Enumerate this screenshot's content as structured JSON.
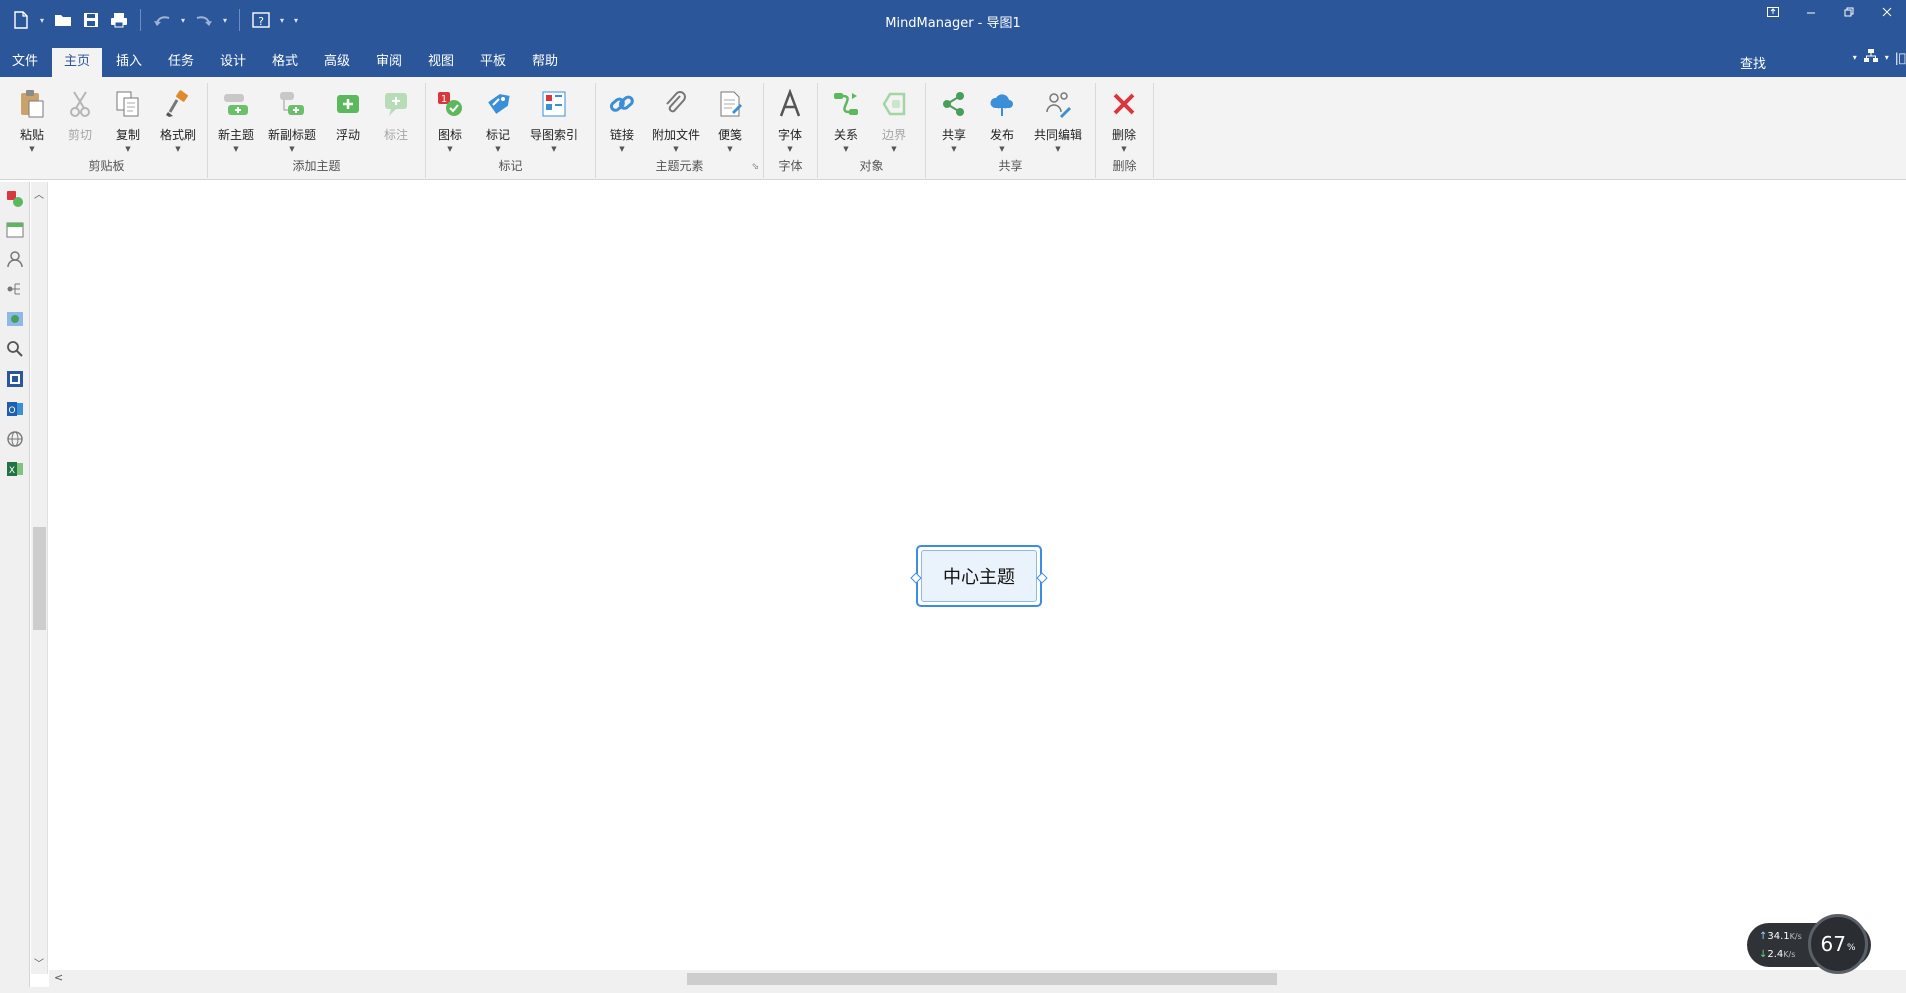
{
  "window": {
    "title": "MindManager - 导图1"
  },
  "quick_access": {
    "icons": [
      "new-file-icon",
      "open-folder-icon",
      "save-icon",
      "print-icon",
      "undo-icon",
      "redo-icon",
      "help-icon"
    ]
  },
  "ribbon_tabs": [
    {
      "id": "file",
      "label": "文件"
    },
    {
      "id": "home",
      "label": "主页",
      "active": true
    },
    {
      "id": "insert",
      "label": "插入"
    },
    {
      "id": "task",
      "label": "任务"
    },
    {
      "id": "design",
      "label": "设计"
    },
    {
      "id": "format",
      "label": "格式"
    },
    {
      "id": "advanced",
      "label": "高级"
    },
    {
      "id": "review",
      "label": "审阅"
    },
    {
      "id": "view",
      "label": "视图"
    },
    {
      "id": "tablet",
      "label": "平板"
    },
    {
      "id": "help",
      "label": "帮助"
    }
  ],
  "search": {
    "label": "查找"
  },
  "ribbon_groups": {
    "clipboard": {
      "label": "剪贴板",
      "buttons": {
        "paste": "粘贴",
        "cut": "剪切",
        "copy": "复制",
        "format_painter": "格式刷"
      }
    },
    "add_topic": {
      "label": "添加主题",
      "buttons": {
        "new_topic": "新主题",
        "new_subtopic": "新副标题",
        "floating": "浮动",
        "callout": "标注"
      }
    },
    "markers": {
      "label": "标记",
      "buttons": {
        "icons": "图标",
        "tags": "标记",
        "map_index": "导图索引"
      }
    },
    "topic_elements": {
      "label": "主题元素",
      "buttons": {
        "link": "链接",
        "attach_file": "附加文件",
        "notes": "便笺"
      }
    },
    "font": {
      "label": "字体",
      "buttons": {
        "font": "字体"
      }
    },
    "objects": {
      "label": "对象",
      "buttons": {
        "relationship": "关系",
        "boundary": "边界"
      }
    },
    "share": {
      "label": "共享",
      "buttons": {
        "share": "共享",
        "publish": "发布",
        "coedit": "共同编辑"
      }
    },
    "delete": {
      "label": "删除",
      "buttons": {
        "delete": "删除"
      }
    }
  },
  "map": {
    "central_topic": "中心主题"
  },
  "network_monitor": {
    "upload": "34.1",
    "upload_unit": "K/s",
    "download": "2.4",
    "download_unit": "K/s",
    "cpu_percent": "67",
    "cpu_unit": "%"
  },
  "colors": {
    "title_bar": "#2b579a",
    "ribbon_bg": "#f3f3f3",
    "topic_border": "#3c8ce6",
    "topic_fill": "#eaf2fc"
  }
}
